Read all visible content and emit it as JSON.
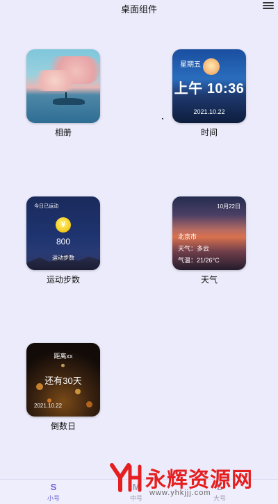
{
  "header": {
    "title": "桌面组件",
    "menu_icon": "menu-icon"
  },
  "widgets": {
    "album": {
      "label": "相册"
    },
    "time": {
      "label": "时间",
      "weekday": "星期五",
      "clock": "上午 10:36",
      "date": "2021.10.22"
    },
    "steps": {
      "label": "运动步数",
      "today": "今日已运动",
      "count": "800",
      "caption": "运动步数",
      "coin_symbol": "¥"
    },
    "weather": {
      "label": "天气",
      "date": "10月22日",
      "city": "北京市",
      "condition": "天气：多云",
      "temperature": "气温：21/26°C"
    },
    "countdown": {
      "label": "倒数日",
      "distance": "距离xx",
      "days_left": "还有30天",
      "date": "2021.10.22"
    }
  },
  "bottom_nav": {
    "items": [
      {
        "icon": "S",
        "label": "小号",
        "active": true
      },
      {
        "icon": "M",
        "label": "中号",
        "active": false
      },
      {
        "icon": "L",
        "label": "大号",
        "active": false
      }
    ]
  },
  "watermark": {
    "brand": "永辉资源网",
    "url": "www.yhkjjj.com"
  },
  "colors": {
    "background": "#ecebfb",
    "accent": "#6a63d6",
    "watermark": "#e51f1f"
  }
}
